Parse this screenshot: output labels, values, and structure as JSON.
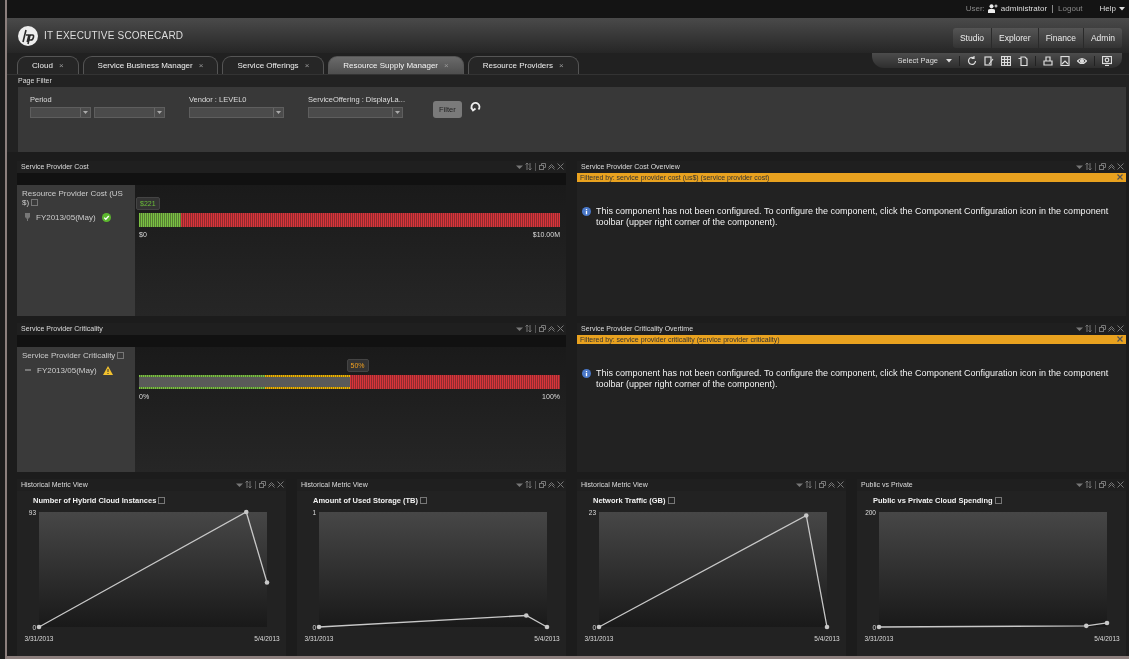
{
  "top_bar": {
    "user_label": "User:",
    "user_name": "administrator",
    "logout": "Logout",
    "help": "Help"
  },
  "header": {
    "title": "IT EXECUTIVE SCORECARD",
    "nav": [
      "Studio",
      "Explorer",
      "Finance",
      "Admin"
    ]
  },
  "tabs": [
    {
      "label": "Cloud",
      "close": "×",
      "selected": false
    },
    {
      "label": "Service Business Manager",
      "close": "×",
      "selected": false
    },
    {
      "label": "Service Offerings",
      "close": "×",
      "selected": false
    },
    {
      "label": "Resource Supply Manager",
      "close": "×",
      "selected": true
    },
    {
      "label": "Resource Providers",
      "close": "×",
      "selected": false
    }
  ],
  "toolbar": {
    "select_page": "Select Page"
  },
  "page_filter": {
    "title": "Page Filter",
    "button": "Filter",
    "fields": [
      {
        "label": "Period",
        "kind": "pair"
      },
      {
        "label": "Vendor : LEVEL0",
        "kind": "single"
      },
      {
        "label": "ServiceOffering : DisplayLa...",
        "kind": "single"
      }
    ]
  },
  "panels": [
    {
      "kind": "gauge",
      "title": "Service Provider Cost",
      "measure": "Resource Provider Cost (US $)",
      "period": "FY2013/05(May)",
      "warning": false,
      "gauge": {
        "kind": "cost",
        "level": 2e-05,
        "marker": "$221",
        "min": "$0",
        "max": "$10.00M"
      }
    },
    {
      "kind": "notice",
      "title": "Service Provider Cost Overview",
      "filter": "Filtered by: service provider cost (us$) (service provider cost)",
      "message": "This component has not been configured. To configure the component, click the Component Configuration icon in the component toolbar (upper right corner of the component)."
    },
    {
      "kind": "gauge",
      "title": "Service Provider Criticality",
      "measure": "Service Provider Criticality",
      "period": "FY2013/05(May)",
      "warning": true,
      "gauge": {
        "kind": "criticality",
        "level": 0.5,
        "marker": "50%",
        "min": "0%",
        "max": "100%"
      }
    },
    {
      "kind": "notice",
      "title": "Service Provider Criticality Overtime",
      "filter": "Filtered by: service provider criticality (service provider criticality)",
      "message": "This component has not been configured. To configure the component, click the Component Configuration icon in the component toolbar (upper right corner of the component)."
    },
    {
      "kind": "chart",
      "title": "Historical Metric View",
      "chart_data": {
        "type": "line",
        "categories": [
          "3/31/2013",
          null,
          null,
          null,
          null,
          null,
          null,
          null,
          null,
          null,
          null,
          "5/4/2013"
        ],
        "series": [
          {
            "name": "Number of Hybrid Cloud Instances",
            "color": "#c8c8c8",
            "values": [
              0,
              null,
              null,
              null,
              null,
              null,
              null,
              null,
              null,
              null,
              93,
              36
            ]
          }
        ],
        "ylim": [
          0,
          93
        ],
        "yticks": [
          0,
          93
        ]
      }
    },
    {
      "kind": "chart",
      "title": "Historical Metric View",
      "chart_data": {
        "type": "line",
        "categories": [
          "3/31/2013",
          null,
          null,
          null,
          null,
          null,
          null,
          null,
          null,
          null,
          null,
          "5/4/2013"
        ],
        "series": [
          {
            "name": "Amount of Used Storage (TB)",
            "color": "#c8c8c8",
            "values": [
              0,
              null,
              null,
              null,
              null,
              null,
              null,
              null,
              null,
              null,
              0.1,
              0
            ]
          }
        ],
        "ylim": [
          0,
          1
        ],
        "yticks": [
          0,
          1
        ]
      }
    },
    {
      "kind": "chart",
      "title": "Historical Metric View",
      "chart_data": {
        "type": "line",
        "categories": [
          "3/31/2013",
          null,
          null,
          null,
          null,
          null,
          null,
          null,
          null,
          null,
          null,
          "5/4/2013"
        ],
        "series": [
          {
            "name": "Network Traffic (GB)",
            "color": "#c8c8c8",
            "values": [
              0,
              null,
              null,
              null,
              null,
              null,
              null,
              null,
              null,
              null,
              22.3,
              0
            ]
          }
        ],
        "ylim": [
          0,
          23
        ],
        "yticks": [
          0,
          23
        ]
      }
    },
    {
      "kind": "chart",
      "title": "Public vs Private",
      "chart_data": {
        "type": "line",
        "categories": [
          "3/31/2013",
          null,
          null,
          null,
          null,
          null,
          null,
          null,
          null,
          null,
          null,
          "5/4/2013"
        ],
        "series": [
          {
            "name": "Public vs Private Cloud Spending",
            "color": "#c8c8c8",
            "values": [
              0,
              null,
              null,
              null,
              null,
              null,
              null,
              null,
              null,
              null,
              2,
              7
            ]
          }
        ],
        "ylim": [
          0,
          200
        ],
        "yticks": [
          0,
          200
        ]
      }
    }
  ]
}
